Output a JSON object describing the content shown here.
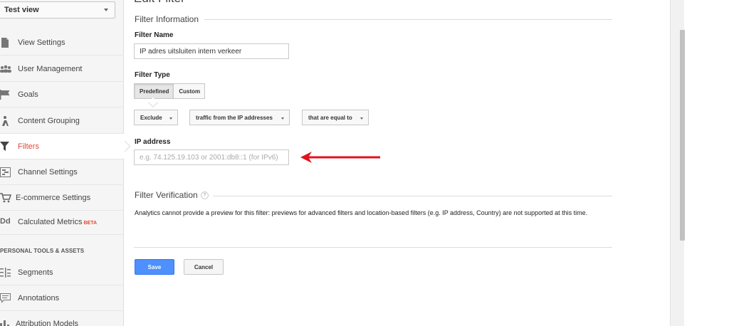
{
  "sidebar": {
    "view_select": "Test view",
    "items": [
      {
        "label": "View Settings",
        "icon": "document-icon"
      },
      {
        "label": "User Management",
        "icon": "users-icon"
      },
      {
        "label": "Goals",
        "icon": "flag-icon"
      },
      {
        "label": "Content Grouping",
        "icon": "person-icon"
      },
      {
        "label": "Filters",
        "icon": "funnel-icon",
        "active": true
      },
      {
        "label": "Channel Settings",
        "icon": "channel-icon"
      },
      {
        "label": "E-commerce Settings",
        "icon": "cart-icon"
      },
      {
        "label": "Calculated Metrics",
        "badge": "BETA",
        "icon_text": "Dd"
      }
    ],
    "section_header": "PERSONAL TOOLS & ASSETS",
    "tools": [
      {
        "label": "Segments",
        "icon": "segments-icon"
      },
      {
        "label": "Annotations",
        "icon": "comment-icon"
      },
      {
        "label": "Attribution Models",
        "icon": "bar-chart-icon"
      }
    ]
  },
  "main": {
    "page_title": "Edit Filter",
    "filter_information": "Filter Information",
    "filter_name_label": "Filter Name",
    "filter_name_value": "IP adres uitsluiten intern verkeer",
    "filter_type_label": "Filter Type",
    "filter_type_tabs": [
      "Predefined",
      "Custom"
    ],
    "dropdowns": [
      "Exclude",
      "traffic from the IP addresses",
      "that are equal to"
    ],
    "ip_label": "IP address",
    "ip_placeholder": "e.g. 74.125.19.103 or 2001:db8::1 (for IPv6)",
    "filter_verification": "Filter Verification",
    "help_glyph": "?",
    "verification_text": "Analytics cannot provide a preview for this filter: previews for advanced filters and location-based filters (e.g. IP address, Country) are not supported at this time.",
    "save_label": "Save",
    "cancel_label": "Cancel"
  },
  "colors": {
    "accent_red": "#dd4b39",
    "save_blue": "#4d90fe",
    "arrow_red": "#e0131b"
  }
}
